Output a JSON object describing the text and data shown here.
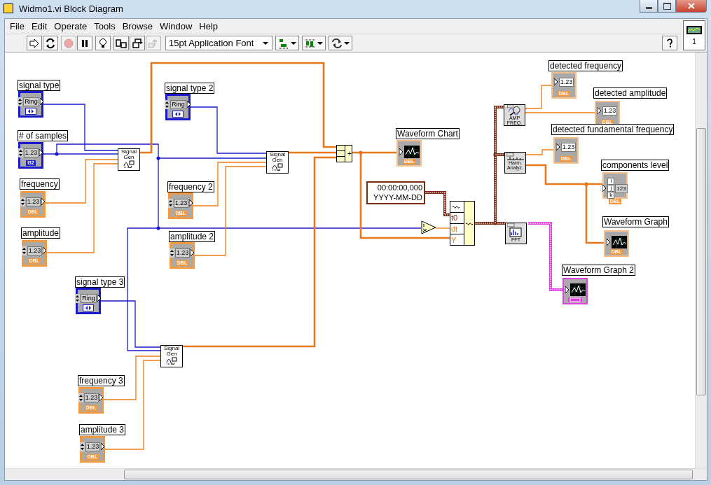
{
  "window": {
    "title": "Widmo1.vi Block Diagram"
  },
  "menu": [
    "File",
    "Edit",
    "Operate",
    "Tools",
    "Browse",
    "Window",
    "Help"
  ],
  "toolbar": {
    "buttons": [
      {
        "kind": "run",
        "disabled": false
      },
      {
        "kind": "run_continuously",
        "disabled": false
      },
      {
        "kind": "abort",
        "disabled": true
      },
      {
        "kind": "pause",
        "disabled": false
      },
      {
        "kind": "highlight",
        "disabled": false
      },
      {
        "kind": "retain",
        "disabled": false
      },
      {
        "kind": "step_into",
        "disabled": false
      },
      {
        "kind": "step_out",
        "disabled": true
      }
    ],
    "font_menu": "15pt Application Font",
    "tool_menus": [
      {
        "kind": "align"
      },
      {
        "kind": "distribute"
      },
      {
        "kind": "reorder"
      }
    ],
    "connector_pane": "1"
  },
  "controls": [
    {
      "label": "signal type",
      "kind": "ring",
      "display": "Ring"
    },
    {
      "label": "# of samples",
      "kind": "i32",
      "display": "1.23",
      "type": "I32"
    },
    {
      "label": "frequency",
      "kind": "dbl",
      "display": "1.23",
      "type": "DBL"
    },
    {
      "label": "amplitude",
      "kind": "dbl",
      "display": "1.23",
      "type": "DBL"
    },
    {
      "label": "signal type 2",
      "kind": "ring",
      "display": "Ring"
    },
    {
      "label": "frequency 2",
      "kind": "dbl",
      "display": "1.23",
      "type": "DBL"
    },
    {
      "label": "amplitude 2",
      "kind": "dbl",
      "display": "1.23",
      "type": "DBL"
    },
    {
      "label": "signal type 3",
      "kind": "ring",
      "display": "Ring"
    },
    {
      "label": "frequency 3",
      "kind": "dbl",
      "display": "1.23",
      "type": "DBL"
    },
    {
      "label": "amplitude 3",
      "kind": "dbl",
      "display": "1.23",
      "type": "DBL"
    }
  ],
  "indicators": [
    {
      "label": "Waveform Chart",
      "kind": "chart",
      "type": "DBL"
    },
    {
      "label": "detected frequency",
      "kind": "numeric",
      "display": "1.23",
      "type": "DBL"
    },
    {
      "label": "detected amplitude",
      "kind": "numeric",
      "display": "1.23",
      "type": "DBL"
    },
    {
      "label": "detected fundamental frequency",
      "kind": "numeric",
      "display": "1.23",
      "type": "DBL"
    },
    {
      "label": "components level",
      "kind": "array",
      "display": "123",
      "index": [
        "i",
        "j",
        "k"
      ],
      "type": "DBL"
    },
    {
      "label": "Waveform Graph",
      "kind": "graph",
      "type": "DBL"
    },
    {
      "label": "Waveform Graph 2",
      "kind": "cluster_graph"
    }
  ],
  "nodes": [
    {
      "kind": "signal_gen",
      "text": "Signal Gen"
    },
    {
      "kind": "signal_gen",
      "text": "Signal Gen"
    },
    {
      "kind": "signal_gen",
      "text": "Signal Gen"
    },
    {
      "kind": "add",
      "text": "+"
    },
    {
      "kind": "timestamp",
      "lines": [
        "00:00:00,000",
        "YYYY-MM-DD"
      ]
    },
    {
      "kind": "reciprocal"
    },
    {
      "kind": "build_waveform",
      "inputs": [
        "t0",
        "dt",
        "Y"
      ]
    },
    {
      "kind": "amp_freq",
      "text": "AMP FREQ."
    },
    {
      "kind": "harmonic",
      "text": "Harm. Analyz."
    },
    {
      "kind": "fft",
      "text": "FFT"
    }
  ]
}
